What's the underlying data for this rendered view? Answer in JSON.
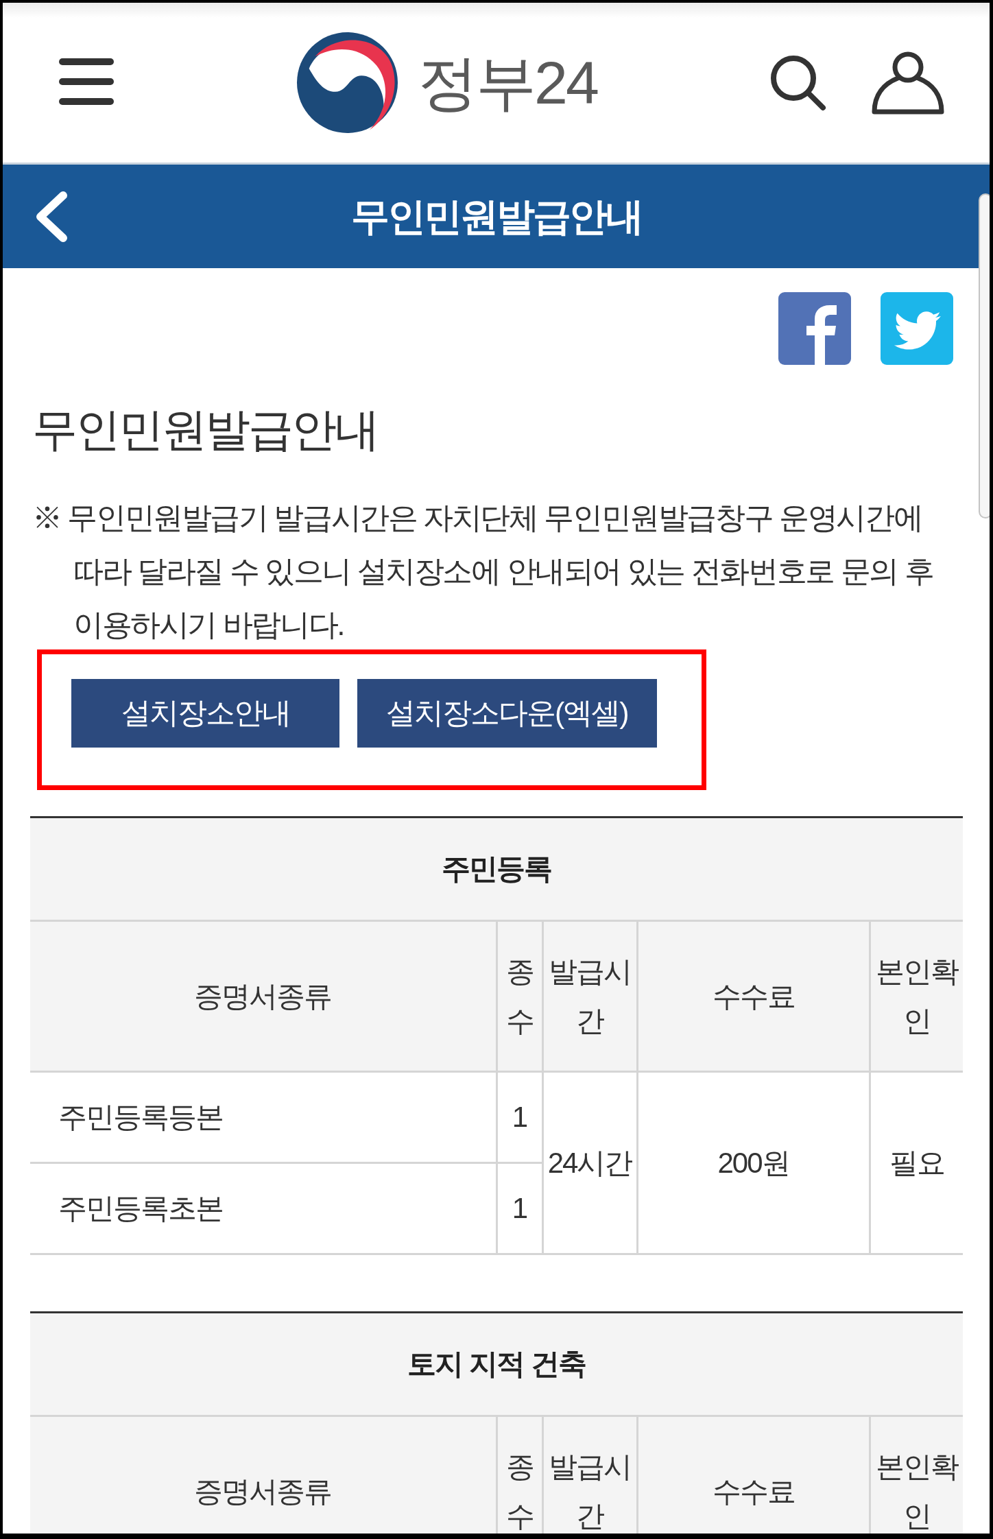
{
  "header": {
    "logo_text": "정부24"
  },
  "title_bar": {
    "title": "무인민원발급안내"
  },
  "heading": "무인민원발급안내",
  "notice": "※ 무인민원발급기 발급시간은 자치단체 무인민원발급창구 운영시간에 따라 달라질 수 있으니 설치장소에 안내되어 있는 전화번호로 문의 후 이용하시기 바랍니다.",
  "button_group": {
    "highlighted": true,
    "buttons": [
      {
        "label": "설치장소안내"
      },
      {
        "label": "설치장소다운(엑셀)"
      }
    ]
  },
  "tables": [
    {
      "caption": "주민등록",
      "columns": [
        "증명서종류",
        "종수",
        "발급시간",
        "수수료",
        "본인확인"
      ],
      "rows": [
        [
          "주민등록등본",
          "1"
        ],
        [
          "주민등록초본",
          "1"
        ]
      ],
      "merged_cells": [
        "24시간",
        "200원",
        "필요"
      ]
    },
    {
      "caption": "토지 지적 건축",
      "columns": [
        "증명서종류",
        "종수",
        "발급시간",
        "수수료",
        "본인확인"
      ]
    }
  ]
}
